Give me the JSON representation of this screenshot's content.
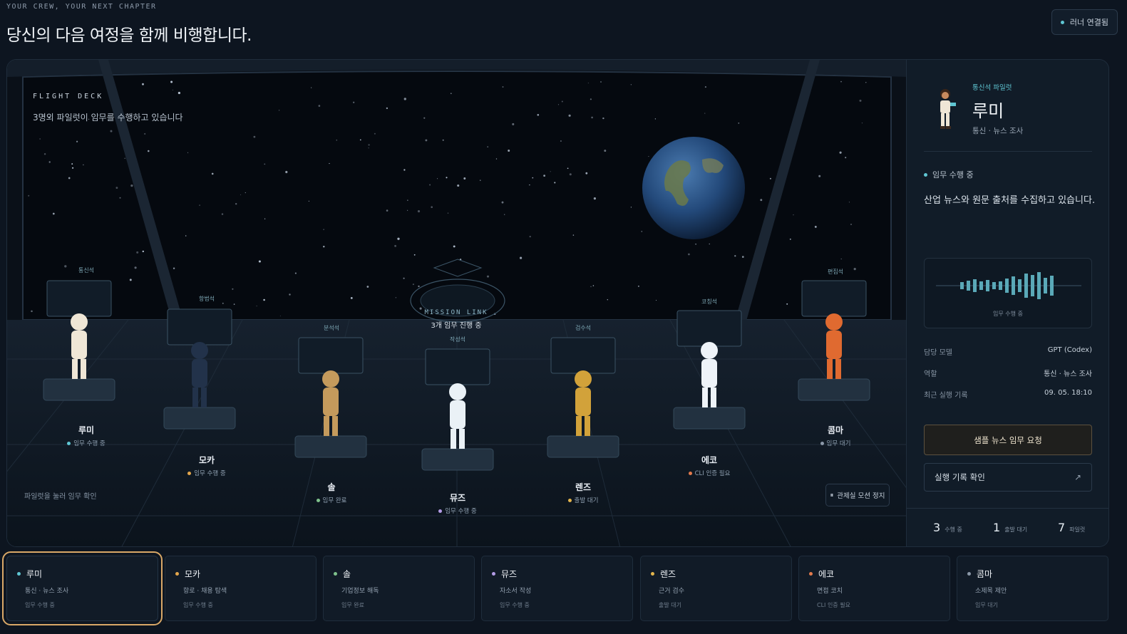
{
  "header": {
    "kicker": "YOUR CREW, YOUR NEXT CHAPTER",
    "title": "당신의 다음 여정을 함께 비행합니다.",
    "runner_status": "러너 연결됨"
  },
  "deck": {
    "label": "FLIGHT DECK",
    "subtitle": "3명의 파일럿이 임무를 수행하고 있습니다",
    "hint": "파일럿을 눌러 임무 확인",
    "pause_button": "관제실 모션 정지",
    "mission_title": "MISSION LINK",
    "mission_status": "3개 임무 진행 중"
  },
  "pilots": [
    {
      "name": "루미",
      "panel": "통신석",
      "status": "임무 수행 중",
      "color": "#5fc6d3"
    },
    {
      "name": "모카",
      "panel": "항법석",
      "status": "임무 수행 중",
      "color": "#e3a64c"
    },
    {
      "name": "솔",
      "panel": "분석석",
      "status": "임무 완료",
      "color": "#7fc28c"
    },
    {
      "name": "뮤즈",
      "panel": "작성석",
      "status": "임무 수행 중",
      "color": "#b39ce6"
    },
    {
      "name": "렌즈",
      "panel": "검수석",
      "status": "출발 대기",
      "color": "#e3b54c"
    },
    {
      "name": "에코",
      "panel": "코칭석",
      "status": "CLI 인증 필요",
      "color": "#e37a4c"
    },
    {
      "name": "콤마",
      "panel": "편집석",
      "status": "임무 대기",
      "color": "#8b98a8"
    }
  ],
  "detail": {
    "role_tag": "통신석 파일럿",
    "name": "루미",
    "subtitle": "통신 · 뉴스 조사",
    "state": "임무 수행 중",
    "description": "산업 뉴스와 원문 출처를 수집하고 있습니다.",
    "wave_caption": "임무 수행 중",
    "kv": [
      {
        "k": "담당 모델",
        "v": "GPT (Codex)"
      },
      {
        "k": "역할",
        "v": "통신 · 뉴스 조사"
      },
      {
        "k": "최근 실행 기록",
        "v": "09. 05. 18:10"
      }
    ],
    "primary_button": "샘플 뉴스 임무 요청",
    "secondary_button": "실행 기록 확인",
    "stats": [
      {
        "n": "3",
        "l": "수행 중"
      },
      {
        "n": "1",
        "l": "출발 대기"
      },
      {
        "n": "7",
        "l": "파일럿"
      }
    ]
  },
  "cards": [
    {
      "name": "루미",
      "role": "통신 · 뉴스 조사",
      "status": "임무 수행 중",
      "color": "#5fc6d3"
    },
    {
      "name": "모카",
      "role": "항로 · 채용 탐색",
      "status": "임무 수행 중",
      "color": "#e3a64c"
    },
    {
      "name": "솔",
      "role": "기업정보 해독",
      "status": "임무 완료",
      "color": "#7fc28c"
    },
    {
      "name": "뮤즈",
      "role": "자소서 작성",
      "status": "임무 수행 중",
      "color": "#b39ce6"
    },
    {
      "name": "렌즈",
      "role": "근거 검수",
      "status": "출발 대기",
      "color": "#e3b54c"
    },
    {
      "name": "에코",
      "role": "면접 코치",
      "status": "CLI 인증 필요",
      "color": "#e37a4c"
    },
    {
      "name": "콤마",
      "role": "소제목 제안",
      "status": "임무 대기",
      "color": "#8b98a8"
    }
  ]
}
